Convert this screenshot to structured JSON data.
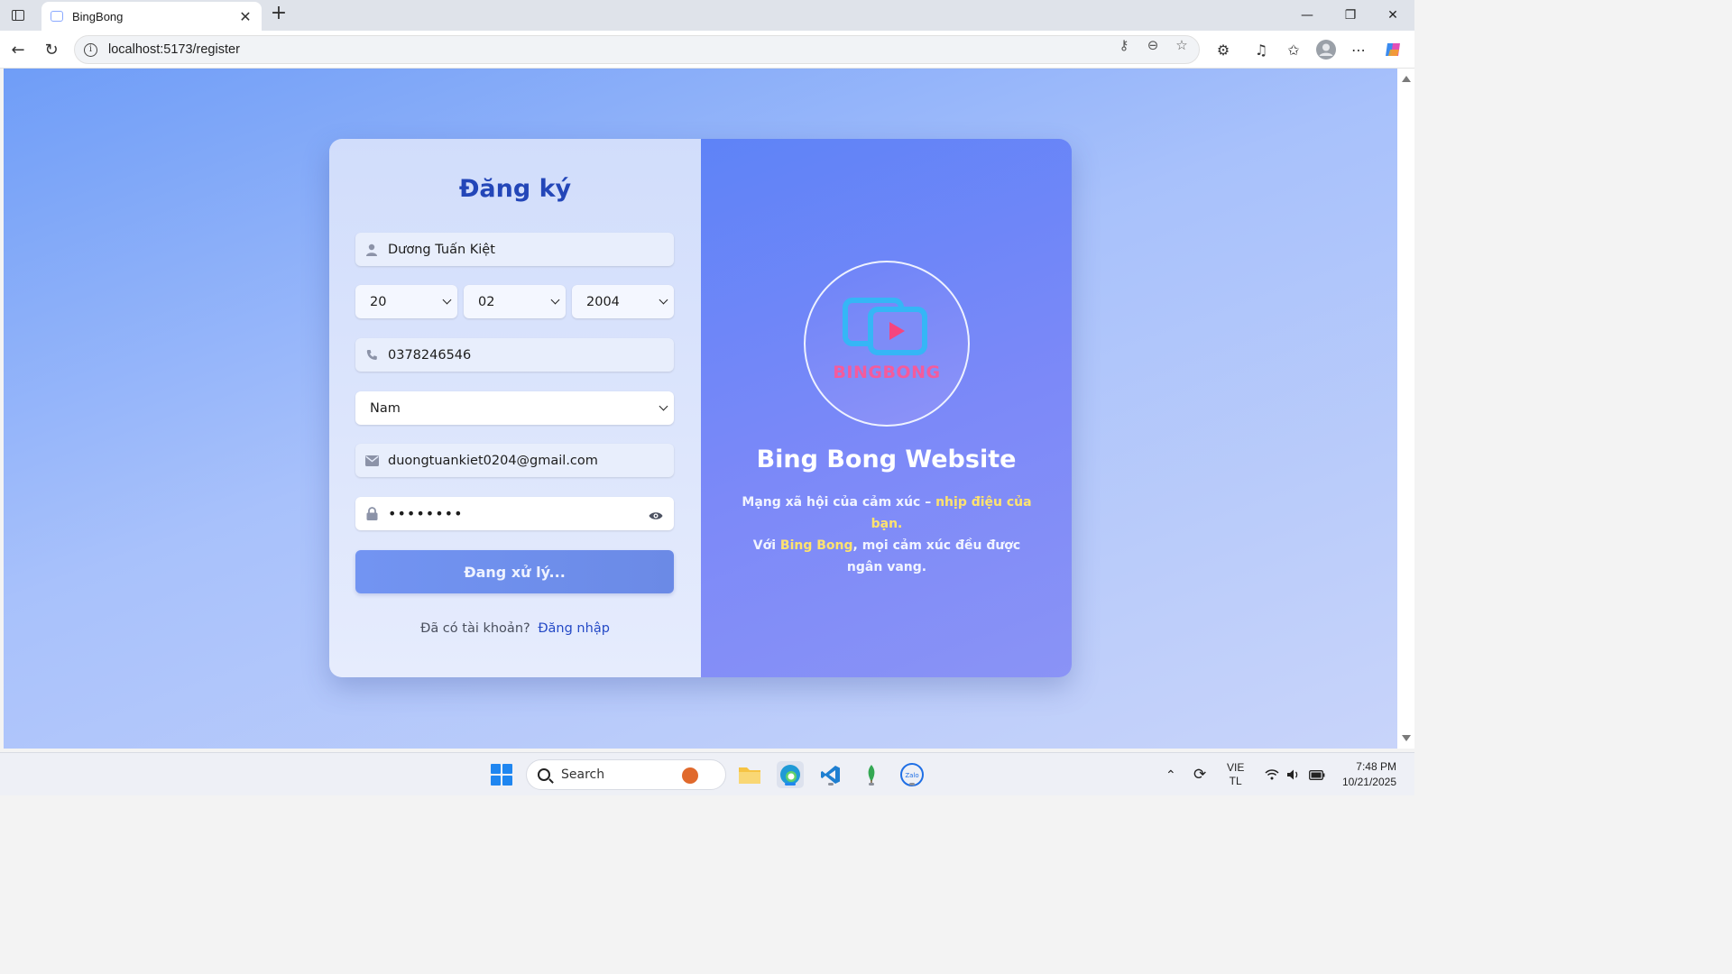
{
  "browser": {
    "tab_title": "BingBong",
    "url": "localhost:5173/register"
  },
  "form": {
    "title": "Đăng ký",
    "name": "Dương Tuấn Kiệt",
    "day": "20",
    "month": "02",
    "year": "2004",
    "phone": "0378246546",
    "gender": "Nam",
    "email": "duongtuankiet0204@gmail.com",
    "password_masked": "••••••••",
    "submit_label": "Đang xử lý...",
    "login_question": "Đã có tài khoản?",
    "login_link": "Đăng nhập"
  },
  "brand": {
    "logo_text": "BINGBONG",
    "title": "Bing Bong Website",
    "desc_1": "Mạng xã hội của cảm xúc – ",
    "desc_1_hl": "nhịp điệu của bạn.",
    "desc_2": "Với ",
    "desc_2_hl": "Bing Bong",
    "desc_3": ", mọi cảm xúc đều được ngân vang."
  },
  "taskbar": {
    "search_label": "Search",
    "lang_1": "VIE",
    "lang_2": "TL",
    "time": "7:48 PM",
    "date": "10/21/2025"
  },
  "colors": {
    "accent_blue": "#2346b8",
    "highlight_yellow": "#ffe36e",
    "logo_pink": "#f45b9c"
  }
}
